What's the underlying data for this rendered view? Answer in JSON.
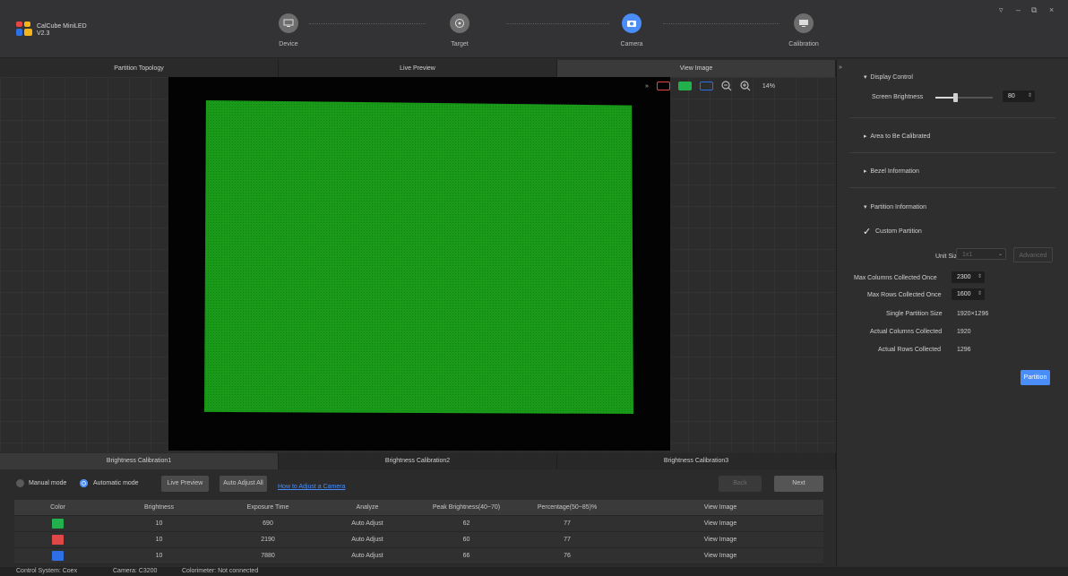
{
  "app": {
    "name": "CalCube MiniLED",
    "version": "V2.3"
  },
  "steps": [
    {
      "label": "Device",
      "icon": "device-icon"
    },
    {
      "label": "Target",
      "icon": "target-icon"
    },
    {
      "label": "Camera",
      "icon": "camera-icon"
    },
    {
      "label": "Calibration",
      "icon": "monitor-icon"
    }
  ],
  "window_controls": [
    "dropdown-icon",
    "minimize-icon",
    "restore-icon",
    "close-icon"
  ],
  "top_tabs": [
    "Partition Topology",
    "Live Preview",
    "View Image"
  ],
  "view_tools": {
    "zoom": "14%"
  },
  "colors": {
    "accent": "#4b8df6",
    "green": "#22b14c",
    "red": "#e04848",
    "blue": "#2f6fe6",
    "panel_green": "#199a19"
  },
  "bottom_tabs": [
    "Brightness Calibration1",
    "Brightness Calibration2",
    "Brightness Calibration3"
  ],
  "controls": {
    "manual_mode": "Manual mode",
    "automatic_mode": "Automatic mode",
    "live_preview": "Live Preview",
    "auto_adjust_all": "Auto Adjust All",
    "help_link": "How to Adjust a Camera",
    "back": "Back",
    "next": "Next"
  },
  "table": {
    "headers": [
      "Color",
      "Brightness",
      "Exposure Time",
      "Analyze",
      "Peak Brightness(40~70)",
      "Percentage(50~85)%",
      "View Image"
    ],
    "rows": [
      {
        "color": "green",
        "brightness": "10",
        "exposure": "690",
        "analyze": "Auto Adjust",
        "peak": "62",
        "percentage": "77",
        "view": "View Image"
      },
      {
        "color": "red",
        "brightness": "10",
        "exposure": "2190",
        "analyze": "Auto Adjust",
        "peak": "60",
        "percentage": "77",
        "view": "View Image"
      },
      {
        "color": "blue",
        "brightness": "10",
        "exposure": "7880",
        "analyze": "Auto Adjust",
        "peak": "66",
        "percentage": "76",
        "view": "View Image"
      }
    ]
  },
  "status": {
    "control_system": "Control System: Coex",
    "camera": "Camera: C3200",
    "colorimeter": "Colorimeter: Not connected"
  },
  "right_panel": {
    "display_control": "Display Control",
    "screen_brightness_label": "Screen Brightness",
    "screen_brightness_value": "80",
    "screen_brightness_level": 0.35,
    "area": "Area to Be Calibrated",
    "bezel": "Bezel Information",
    "partition_info": "Partition Information",
    "custom_partition": "Custom Partition",
    "unit_size_label": "Unit Size",
    "unit_size_value": "1x1",
    "advanced": "Advanced",
    "max_cols_label": "Max Columns Collected Once",
    "max_cols_value": "2300",
    "max_rows_label": "Max Rows Collected Once",
    "max_rows_value": "1600",
    "single_size_label": "Single Partition Size",
    "single_size_value": "1920×1296",
    "actual_cols_label": "Actual Columns Collected",
    "actual_cols_value": "1920",
    "actual_rows_label": "Actual Rows Collected",
    "actual_rows_value": "1296",
    "partition_btn": "Partition"
  }
}
